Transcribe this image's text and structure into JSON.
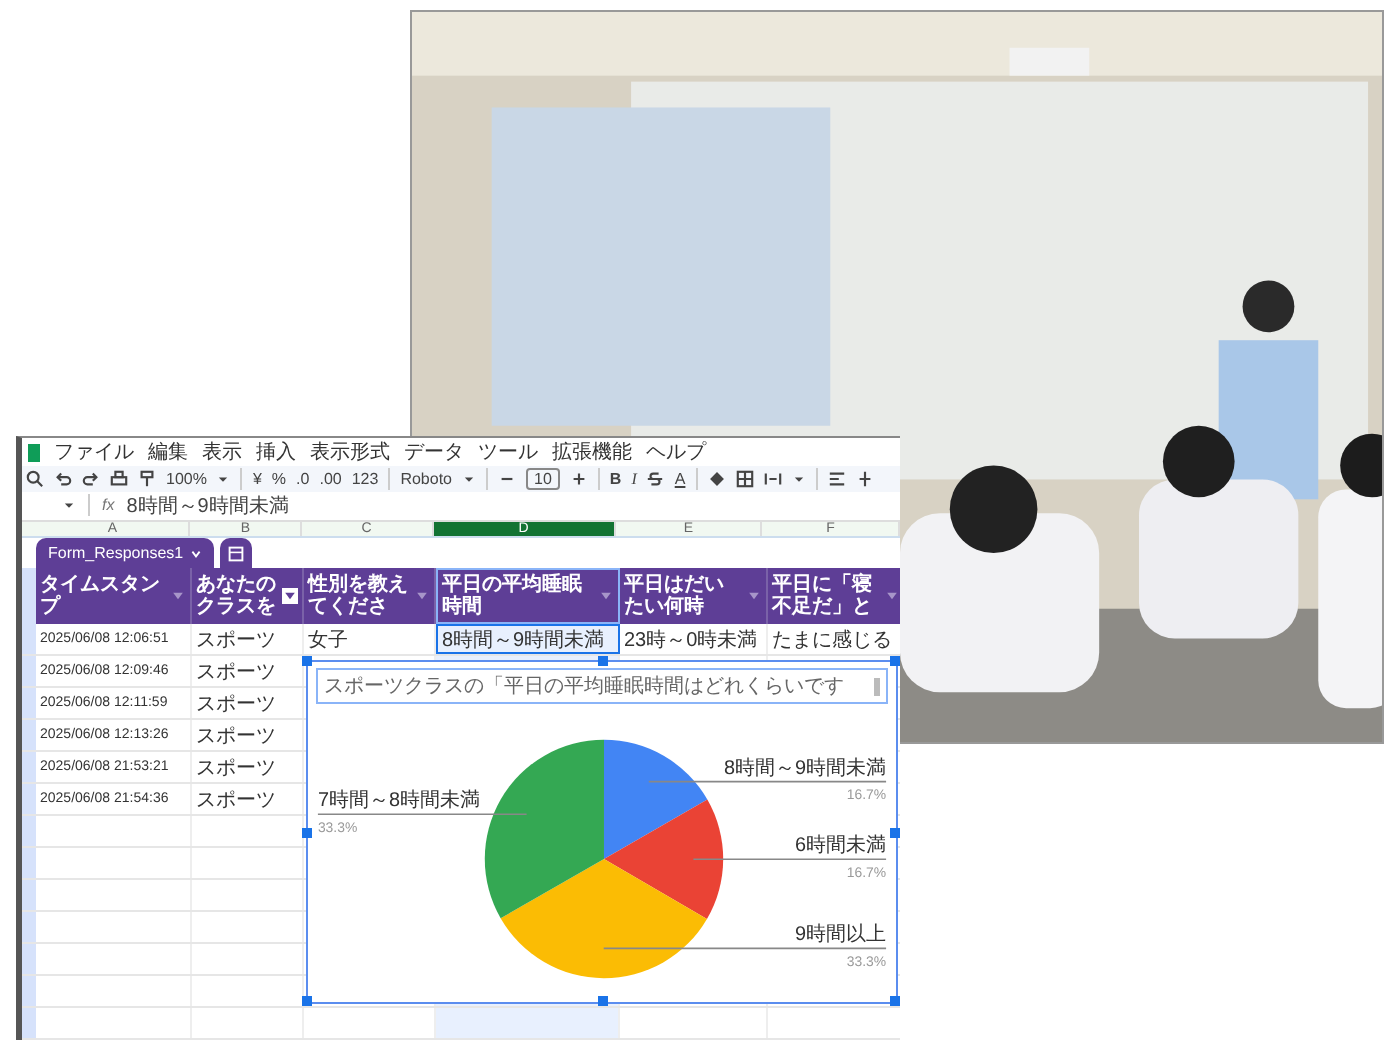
{
  "spreadsheet": {
    "menu": [
      "ファイル",
      "編集",
      "表示",
      "挿入",
      "表示形式",
      "データ",
      "ツール",
      "拡張機能",
      "ヘルプ"
    ],
    "toolbar": {
      "zoom": "100%",
      "currency": "¥",
      "percent": "%",
      "decimal_decrease": ".0",
      "decimal_increase": ".00",
      "number_format": "123",
      "font": "Roboto",
      "font_size": "10",
      "bold": "B",
      "italic": "I",
      "text_color": "A"
    },
    "formula_bar": {
      "label": "fx",
      "value": "8時間～9時間未満"
    },
    "columns": [
      {
        "letter": "A",
        "selected": false
      },
      {
        "letter": "B",
        "selected": false
      },
      {
        "letter": "C",
        "selected": false
      },
      {
        "letter": "D",
        "selected": true
      },
      {
        "letter": "E",
        "selected": false
      },
      {
        "letter": "F",
        "selected": false
      }
    ],
    "sheet_tabs": [
      {
        "label": "Form_Responses1",
        "selected": true
      }
    ],
    "header": [
      {
        "text": "タイムスタンプ",
        "filtered": false
      },
      {
        "text": "あなたのクラスを",
        "filtered": true
      },
      {
        "text": "性別を教えてくださ",
        "filtered": false
      },
      {
        "text": "平日の平均睡眠時間",
        "filtered": false
      },
      {
        "text": "平日はだいたい何時",
        "filtered": false
      },
      {
        "text": "平日に「寝不足だ」と",
        "filtered": false
      }
    ],
    "rows": [
      {
        "cells": [
          {
            "text": "2025/06/08 12:06:51",
            "selected": false
          },
          {
            "text": "スポーツ",
            "selected": false
          },
          {
            "text": "女子",
            "selected": false
          },
          {
            "text": "8時間～9時間未満",
            "selected": true
          },
          {
            "text": "23時～0時未満",
            "selected": false
          },
          {
            "text": "たまに感じる",
            "selected": false
          }
        ]
      },
      {
        "cells": [
          {
            "text": "2025/06/08 12:09:46",
            "selected": false
          },
          {
            "text": "スポーツ",
            "selected": false
          }
        ]
      },
      {
        "cells": [
          {
            "text": "2025/06/08 12:11:59",
            "selected": false
          },
          {
            "text": "スポーツ",
            "selected": false
          }
        ]
      },
      {
        "cells": [
          {
            "text": "2025/06/08 12:13:26",
            "selected": false
          },
          {
            "text": "スポーツ",
            "selected": false
          }
        ]
      },
      {
        "cells": [
          {
            "text": "2025/06/08 21:53:21",
            "selected": false
          },
          {
            "text": "スポーツ",
            "selected": false
          }
        ]
      },
      {
        "cells": [
          {
            "text": "2025/06/08 21:54:36",
            "selected": false
          },
          {
            "text": "スポーツ",
            "selected": false
          }
        ]
      }
    ],
    "chart": {
      "chart_data": {
        "type": "pie",
        "title": "スポーツクラスの「平日の平均睡眠時間はどれくらいです",
        "categories": [
          "8時間～9時間未満",
          "6時間未満",
          "9時間以上",
          "7時間～8時間未満"
        ],
        "values": [
          16.7,
          16.7,
          33.3,
          33.3
        ],
        "value_labels": [
          "16.7%",
          "16.7%",
          "33.3%",
          "33.3%"
        ]
      }
    }
  }
}
